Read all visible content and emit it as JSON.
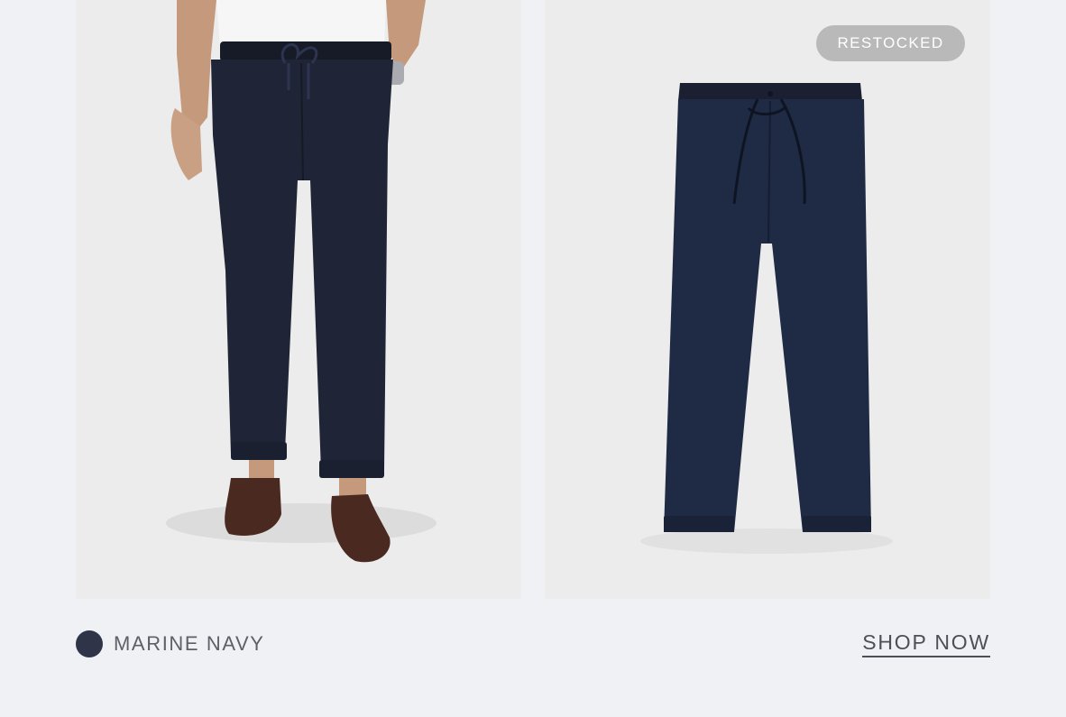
{
  "product": {
    "badge_label": "RESTOCKED",
    "color_name": "MARINE NAVY",
    "color_swatch": "#2f3449",
    "shop_label": "SHOP NOW"
  },
  "colors": {
    "page_bg": "#f0f1f4",
    "image_bg": "#ececec",
    "navy": "#1f2536",
    "badge_bg": "#b9b9b9"
  },
  "images": {
    "left": "model-wearing-pants-photo",
    "right": "flat-lay-pants-photo"
  }
}
